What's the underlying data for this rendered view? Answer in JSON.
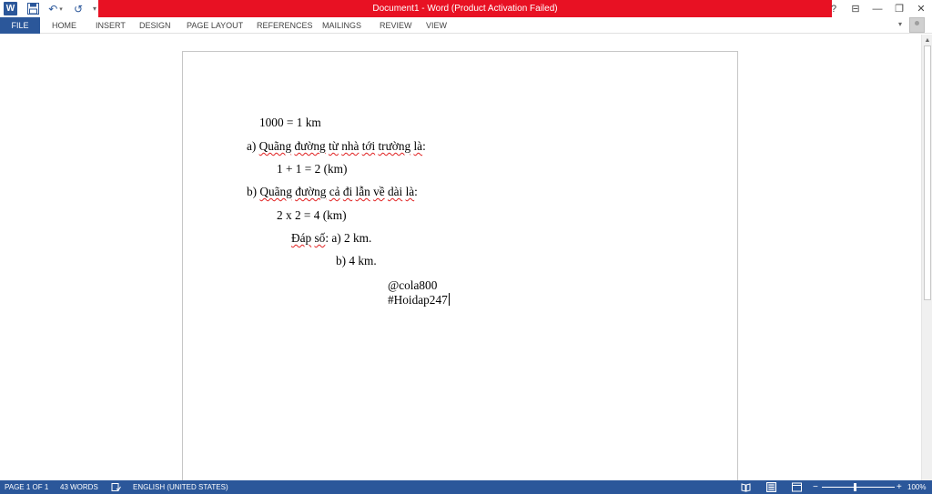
{
  "titlebar": {
    "title": "Document1 -  Word (Product Activation Failed)",
    "app_icon_letter": "W",
    "undo_glyph": "↶",
    "redo_glyph": "↺",
    "qat_customize_glyph": "▾",
    "help_glyph": "?",
    "minimize_glyph": "—",
    "restore_glyph": "❐",
    "close_glyph": "✕",
    "ribbon_display_glyph": "⊟"
  },
  "ribbon": {
    "tabs": [
      "FILE",
      "HOME",
      "INSERT",
      "DESIGN",
      "PAGE LAYOUT",
      "REFERENCES",
      "MAILINGS",
      "REVIEW",
      "VIEW"
    ],
    "collapse_glyph": "▾"
  },
  "document": {
    "lines": [
      "1000 = 1 km",
      "a) Quãng đường từ nhà tới trường là:",
      "1 + 1 = 2 (km)",
      "b) Quãng đường cả đi lẫn về dài là:",
      "2 x 2 = 4 (km)",
      "Đáp số: a) 2 km.",
      "b) 4 km.",
      "@cola800",
      "#Hoidap247"
    ],
    "line2": {
      "prefix": "a) ",
      "w1": "Quãng",
      "w2": "đường",
      "w3": "từ",
      "w4": "nhà",
      "w5": "tới",
      "w6": "trường",
      "w7": "là",
      "suffix": ":"
    },
    "line4": {
      "prefix": "b) ",
      "w1": "Quãng",
      "w2": "đường",
      "w3": "cả",
      "w4": "đi",
      "w5": "lẫn",
      "w6": "về",
      "w7": "dài",
      "w8": "là",
      "suffix": ":"
    },
    "line6": {
      "w1": "Đáp",
      "w2": "số",
      "rest": ": a) 2 km."
    }
  },
  "statusbar": {
    "page": "PAGE 1 OF 1",
    "words": "43 WORDS",
    "language": "ENGLISH (UNITED STATES)",
    "zoom_minus": "−",
    "zoom_plus": "+",
    "zoom": "100%",
    "zoom_value_percent": 100
  },
  "colors": {
    "accent": "#2b579a",
    "title_alert": "#e81123"
  }
}
